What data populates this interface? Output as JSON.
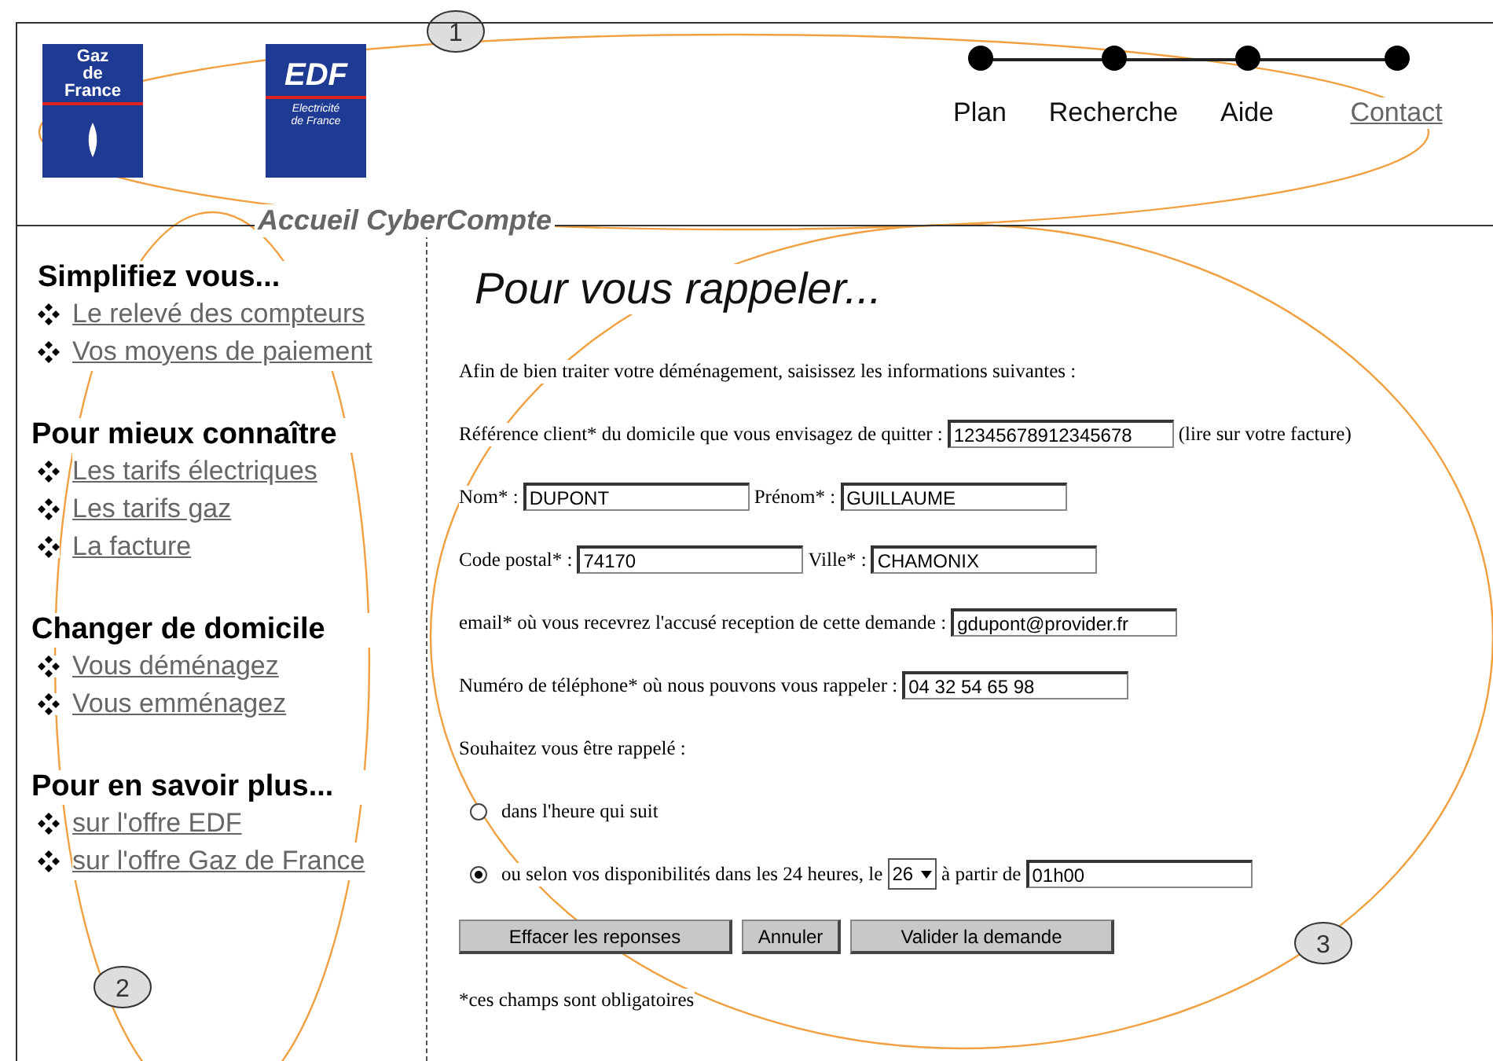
{
  "header": {
    "logos": [
      {
        "kind": "gdf",
        "lines": [
          "Gaz",
          "de",
          "France"
        ]
      },
      {
        "kind": "edf",
        "title": "EDF",
        "lines": [
          "Electricité",
          "de France"
        ]
      }
    ],
    "nav": [
      {
        "label": "Plan",
        "kind": "plain"
      },
      {
        "label": "Recherche",
        "kind": "plain"
      },
      {
        "label": "Aide",
        "kind": "plain"
      },
      {
        "label": "Contact",
        "kind": "link"
      }
    ],
    "site_title": "Accueil CyberCompte"
  },
  "sidebar": {
    "sections": [
      {
        "heading": "Simplifiez vous...",
        "links": [
          "Le relevé des compteurs",
          "Vos moyens de paiement"
        ]
      },
      {
        "heading": "Pour mieux connaître",
        "links": [
          "Les tarifs électriques",
          "Les tarifs gaz",
          "La facture"
        ]
      },
      {
        "heading": "Changer de domicile",
        "links": [
          "Vous déménagez",
          "Vous emménagez"
        ]
      },
      {
        "heading": "Pour en savoir plus...",
        "links": [
          "sur l'offre EDF",
          "sur l'offre Gaz de France"
        ]
      }
    ]
  },
  "content": {
    "title": "Pour vous rappeler...",
    "lines": [
      {
        "parts": [
          {
            "kind": "label",
            "text": "Afin de bien traiter votre déménagement, saisissez les informations suivantes :"
          }
        ]
      },
      {
        "parts": [
          {
            "kind": "label",
            "text": "Référence client* du domicile que vous envisagez de quitter :"
          },
          {
            "kind": "input",
            "value": "12345678912345678"
          },
          {
            "kind": "label",
            "text": "(lire sur votre facture)"
          }
        ]
      },
      {
        "parts": [
          {
            "kind": "label",
            "text": "Nom* :"
          },
          {
            "kind": "input",
            "value": "DUPONT"
          },
          {
            "kind": "label",
            "text": "Prénom* :"
          },
          {
            "kind": "input",
            "value": "GUILLAUME"
          }
        ]
      },
      {
        "parts": [
          {
            "kind": "label",
            "text": "Code postal* :"
          },
          {
            "kind": "input",
            "value": "74170"
          },
          {
            "kind": "label",
            "text": "Ville* :"
          },
          {
            "kind": "input",
            "value": "CHAMONIX"
          }
        ]
      },
      {
        "parts": [
          {
            "kind": "label",
            "text": "email* où vous recevrez l'accusé reception de cette demande :"
          },
          {
            "kind": "input",
            "value": "gdupont@provider.fr"
          }
        ]
      },
      {
        "parts": [
          {
            "kind": "label",
            "text": "Numéro de téléphone* où nous pouvons vous rappeler :"
          },
          {
            "kind": "input",
            "value": "04 32 54 65 98"
          }
        ]
      },
      {
        "parts": [
          {
            "kind": "label",
            "text": "Souhaitez vous être rappelé :"
          }
        ]
      },
      {
        "parts": [
          {
            "kind": "radio",
            "selected": false
          },
          {
            "kind": "label",
            "text": "dans l'heure qui suit"
          }
        ]
      },
      {
        "parts": [
          {
            "kind": "radio",
            "selected": true
          },
          {
            "kind": "label",
            "text": "ou selon vos disponibilités dans les 24 heures, le"
          },
          {
            "kind": "select",
            "value": "26"
          },
          {
            "kind": "label",
            "text": "à partir de"
          },
          {
            "kind": "input",
            "value": "01h00"
          }
        ]
      }
    ],
    "buttons": [
      "Effacer les reponses",
      "Annuler",
      "Valider la demande"
    ],
    "note": "*ces champs sont obligatoires"
  },
  "annotations": [
    {
      "number": "1"
    },
    {
      "number": "2"
    },
    {
      "number": "3"
    }
  ]
}
